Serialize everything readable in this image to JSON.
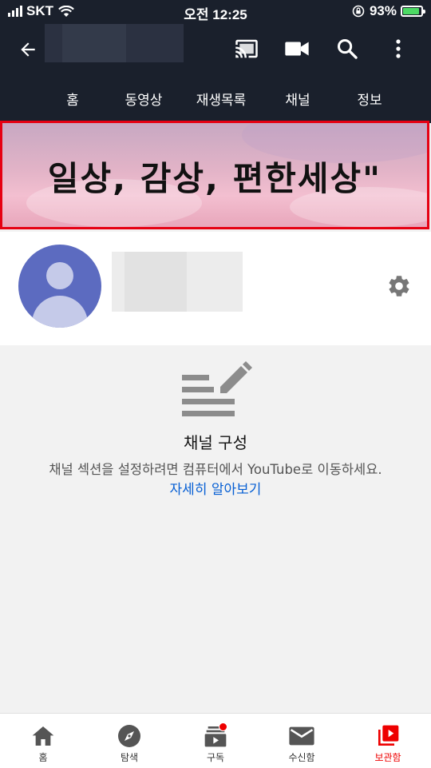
{
  "status_bar": {
    "carrier": "SKT",
    "time": "오전 12:25",
    "battery": "93%",
    "battery_level": 0.93
  },
  "app_bar": {
    "icons": [
      "back-arrow-icon",
      "cast-icon",
      "video-camera-icon",
      "search-icon",
      "more-vert-icon"
    ]
  },
  "tabs": [
    {
      "label": "홈",
      "active": true
    },
    {
      "label": "동영상"
    },
    {
      "label": "재생목록"
    },
    {
      "label": "채널"
    },
    {
      "label": "정보"
    }
  ],
  "banner": {
    "text": "일상, 감상, 편한세상\"",
    "border_color": "#e60012"
  },
  "profile": {
    "settings_icon": "gear-icon"
  },
  "empty_state": {
    "icon": "edit-list-icon",
    "title": "채널 구성",
    "description": "채널 섹션을 설정하려면 컴퓨터에서 YouTube로 이동하세요.",
    "link": "자세히 알아보기"
  },
  "bottom_nav": [
    {
      "label": "홈",
      "icon": "home-icon"
    },
    {
      "label": "탐색",
      "icon": "compass-icon"
    },
    {
      "label": "구독",
      "icon": "subscriptions-icon",
      "badge": true
    },
    {
      "label": "수신함",
      "icon": "mail-icon"
    },
    {
      "label": "보관함",
      "icon": "library-icon",
      "active": true
    }
  ],
  "colors": {
    "header_bg": "#1a202c",
    "accent_red": "#e00000",
    "link_blue": "#065fd4",
    "avatar": "#5c6bc0"
  }
}
